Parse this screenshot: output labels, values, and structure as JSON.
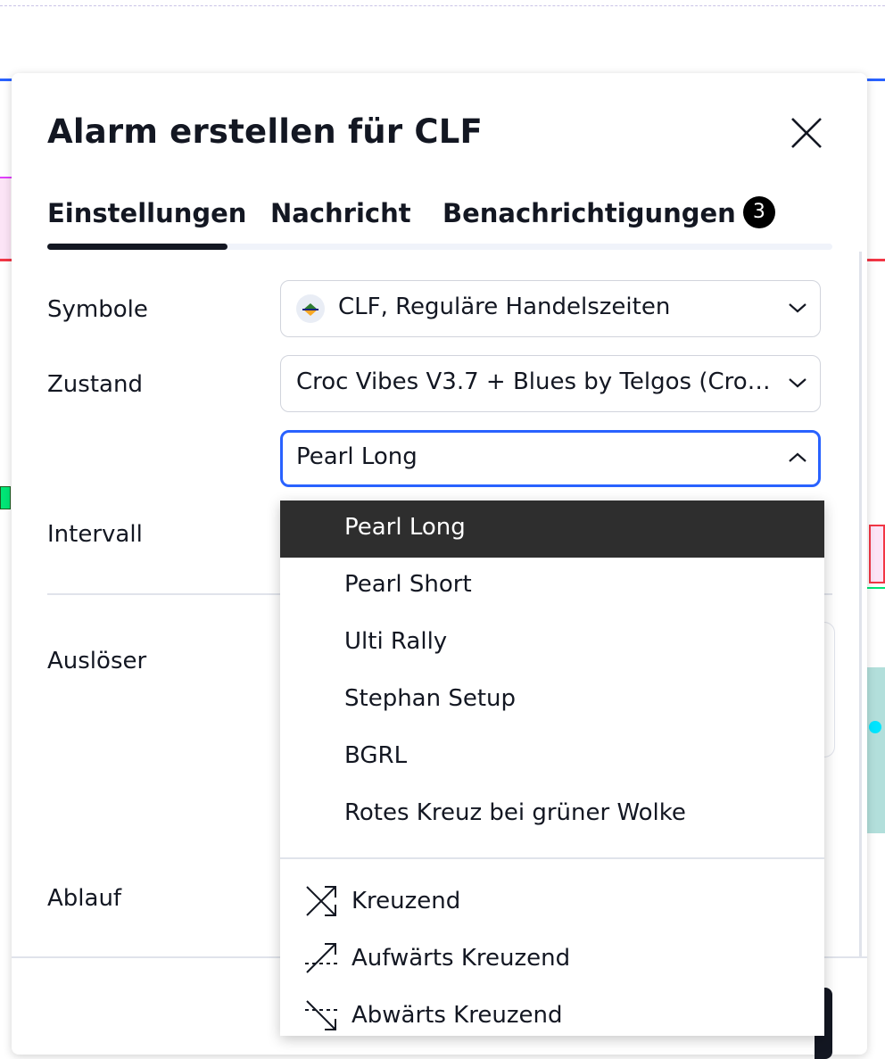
{
  "dialog": {
    "title": "Alarm erstellen für CLF",
    "close_icon": "close-icon"
  },
  "tabs": [
    {
      "label": "Einstellungen",
      "active": true
    },
    {
      "label": "Nachricht",
      "active": false
    },
    {
      "label": "Benachrichtigungen",
      "badge": "3",
      "active": false
    }
  ],
  "form": {
    "symbol_label": "Symbole",
    "symbol_value": "CLF, Reguläre Handelszeiten",
    "condition_label": "Zustand",
    "condition_value": "Croc Vibes V3.7 + Blues by Telgos (Croc 3...",
    "condition_sub_value": "Pearl Long",
    "interval_label": "Intervall",
    "trigger_label": "Auslöser",
    "expiry_label": "Ablauf"
  },
  "dropdown": {
    "options": [
      {
        "label": "Pearl Long",
        "selected": true
      },
      {
        "label": "Pearl Short"
      },
      {
        "label": "Ulti Rally"
      },
      {
        "label": "Stephan Setup"
      },
      {
        "label": "BGRL"
      },
      {
        "label": "Rotes Kreuz bei grüner Wolke"
      }
    ],
    "cross_options": [
      {
        "label": "Kreuzend",
        "icon": "crossing-icon"
      },
      {
        "label": "Aufwärts Kreuzend",
        "icon": "crossing-up-icon"
      },
      {
        "label": "Abwärts Kreuzend",
        "icon": "crossing-down-icon"
      }
    ]
  },
  "colors": {
    "accent_blue": "#2962ff",
    "selected_bg": "#2e2e2e",
    "text": "#131722"
  }
}
